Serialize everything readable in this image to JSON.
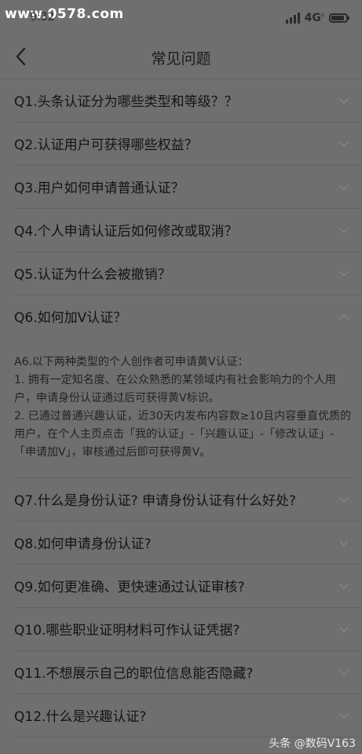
{
  "status_bar": {
    "watermark": "www.0578.com",
    "time": "9:32",
    "network": "4G"
  },
  "header": {
    "title": "常见问题"
  },
  "faq": [
    {
      "q": "Q1.头条认证分为哪些类型和等级？？",
      "expanded": false
    },
    {
      "q": "Q2.认证用户可获得哪些权益？",
      "expanded": false
    },
    {
      "q": "Q3.用户如何申请普通认证？",
      "expanded": false
    },
    {
      "q": "Q4.个人申请认证后如何修改或取消？",
      "expanded": false
    },
    {
      "q": "Q5.认证为什么会被撤销？",
      "expanded": false
    },
    {
      "q": "Q6.如何加V认证？",
      "expanded": true,
      "answer": [
        "A6.以下两种类型的个人创作者可申请黄V认证：",
        "1. 拥有一定知名度、在公众熟悉的某领域内有社会影响力的个人用户，申请身份认证通过后可获得黄V标识。",
        "2. 已通过普通兴趣认证，近30天内发布内容数≥10且内容垂直优质的用户，在个人主页点击「我的认证」-「兴趣认证」-「修改认证」-「申请加V」，审核通过后即可获得黄V。"
      ]
    },
    {
      "q": "Q7.什么是身份认证? 申请身份认证有什么好处?",
      "expanded": false
    },
    {
      "q": "Q8.如何申请身份认证?",
      "expanded": false
    },
    {
      "q": "Q9.如何更准确、更快速通过认证审核?",
      "expanded": false
    },
    {
      "q": "Q10.哪些职业证明材料可作认证凭据?",
      "expanded": false
    },
    {
      "q": "Q11.不想展示自己的职位信息能否隐藏?",
      "expanded": false
    },
    {
      "q": "Q12.什么是兴趣认证?",
      "expanded": false
    }
  ],
  "watermark_bottom": "头条 @数码V163"
}
